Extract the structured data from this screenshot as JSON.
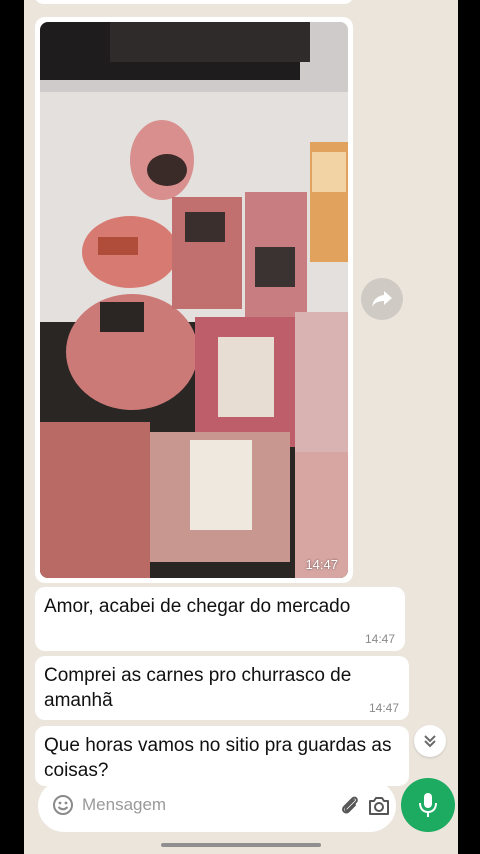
{
  "media_message": {
    "time": "14:47"
  },
  "messages": [
    {
      "text": "Amor, acabei de chegar do mercado",
      "time": "14:47"
    },
    {
      "text": "Comprei as carnes pro churrasco de amanhã",
      "time": "14:47"
    },
    {
      "text": "Que horas vamos no sitio pra guardas as coisas?",
      "time": ""
    }
  ],
  "composer": {
    "placeholder": "Mensagem"
  },
  "colors": {
    "chat_background": "#ebe5dc",
    "accent": "#1daa61",
    "bubble": "#ffffff"
  },
  "icons": [
    "forward-icon",
    "chevron-double-down-icon",
    "emoji-icon",
    "paperclip-icon",
    "camera-icon",
    "mic-icon"
  ]
}
